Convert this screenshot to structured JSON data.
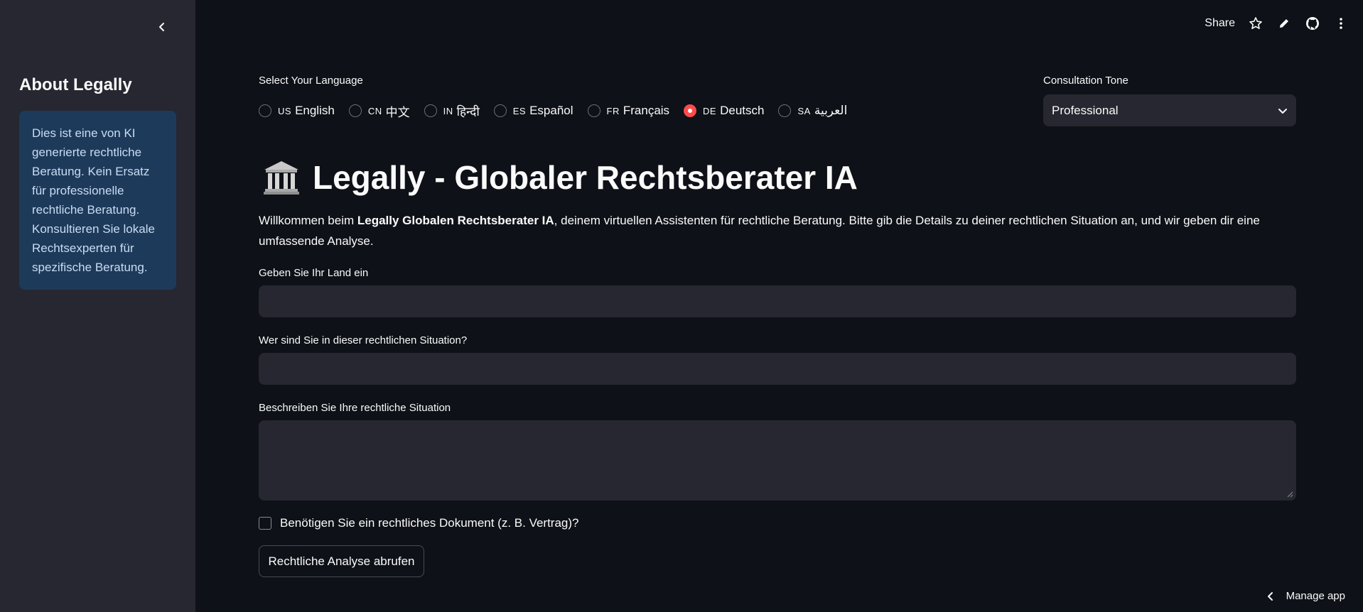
{
  "sidebar": {
    "title": "About Legally",
    "info": "Dies ist eine von KI generierte rechtliche Beratung. Kein Ersatz für professionelle rechtliche Beratung. Konsultieren Sie lokale Rechtsexperten für spezifische Beratung."
  },
  "toolbar": {
    "share_label": "Share"
  },
  "language": {
    "label": "Select Your Language",
    "options": [
      {
        "code": "US",
        "label": "English",
        "selected": false
      },
      {
        "code": "CN",
        "label": "中文",
        "selected": false
      },
      {
        "code": "IN",
        "label": "हिन्दी",
        "selected": false
      },
      {
        "code": "ES",
        "label": "Español",
        "selected": false
      },
      {
        "code": "FR",
        "label": "Français",
        "selected": false
      },
      {
        "code": "DE",
        "label": "Deutsch",
        "selected": true
      },
      {
        "code": "SA",
        "label": "العربية",
        "selected": false
      }
    ]
  },
  "tone": {
    "label": "Consultation Tone",
    "value": "Professional"
  },
  "header": {
    "icon": "🏛️",
    "title": "Legally - Globaler Rechtsberater IA"
  },
  "intro": {
    "prefix": "Willkommen beim ",
    "bold": "Legally Globalen Rechtsberater IA",
    "suffix": ", deinem virtuellen Assistenten für rechtliche Beratung. Bitte gib die Details zu deiner rechtlichen Situation an, und wir geben dir eine umfassende Analyse."
  },
  "form": {
    "country_label": "Geben Sie Ihr Land ein",
    "country_value": "",
    "role_label": "Wer sind Sie in dieser rechtlichen Situation?",
    "role_value": "",
    "situation_label": "Beschreiben Sie Ihre rechtliche Situation",
    "situation_value": "",
    "document_checkbox_label": "Benötigen Sie ein rechtliches Dokument (z. B. Vertrag)?",
    "document_checked": false,
    "submit_label": "Rechtliche Analyse abrufen"
  },
  "footer": {
    "manage_label": "Manage app"
  },
  "colors": {
    "background": "#0e1117",
    "sidebar": "#262730",
    "info_box": "#1e3a5a",
    "accent": "#ff4b4b"
  }
}
